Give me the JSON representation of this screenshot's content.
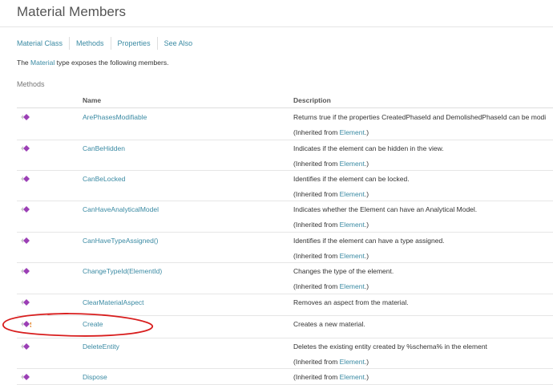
{
  "page": {
    "title": "Material Members",
    "tabs": [
      "Material Class",
      "Methods",
      "Properties",
      "See Also"
    ],
    "intro_before": "The ",
    "intro_link": "Material",
    "intro_after": " type exposes the following members.",
    "section_title": "Methods"
  },
  "table": {
    "headers": {
      "name": "Name",
      "description": "Description"
    },
    "inherit_prefix": "(Inherited from ",
    "inherit_suffix": ".)",
    "rows": [
      {
        "name": "ArePhasesModifiable",
        "desc": "Returns true if the properties CreatedPhaseId and DemolishedPhaseId can be modi",
        "inherited": "Element",
        "static": false
      },
      {
        "name": "CanBeHidden",
        "desc": "Indicates if the element can be hidden in the view.",
        "inherited": "Element",
        "static": false
      },
      {
        "name": "CanBeLocked",
        "desc": "Identifies if the element can be locked.",
        "inherited": "Element",
        "static": false
      },
      {
        "name": "CanHaveAnalyticalModel",
        "desc": "Indicates whether the Element can have an Analytical Model.",
        "inherited": "Element",
        "static": false
      },
      {
        "name": "CanHaveTypeAssigned()",
        "desc": "Identifies if the element can have a type assigned.",
        "inherited": "Element",
        "static": false
      },
      {
        "name": "ChangeTypeId(ElementId)",
        "desc": "Changes the type of the element.",
        "inherited": "Element",
        "static": false
      },
      {
        "name": "ClearMaterialAspect",
        "desc": "Removes an aspect from the material.",
        "inherited": "",
        "static": false
      },
      {
        "name": "Create",
        "desc": "Creates a new material.",
        "inherited": "",
        "static": true,
        "static_mark": "S"
      },
      {
        "name": "DeleteEntity",
        "desc": "Deletes the existing entity created by %schema% in the element",
        "inherited": "Element",
        "static": false
      },
      {
        "name": "Dispose",
        "desc": "",
        "inherited": "Element",
        "static": false
      }
    ]
  },
  "colors": {
    "link": "#3a8aa3",
    "method_icon": "#9b3fb5",
    "static_mark": "#e07a1a",
    "annotation": "#d81e1e"
  },
  "icons": {
    "method": "method-icon",
    "static": "static-icon"
  }
}
